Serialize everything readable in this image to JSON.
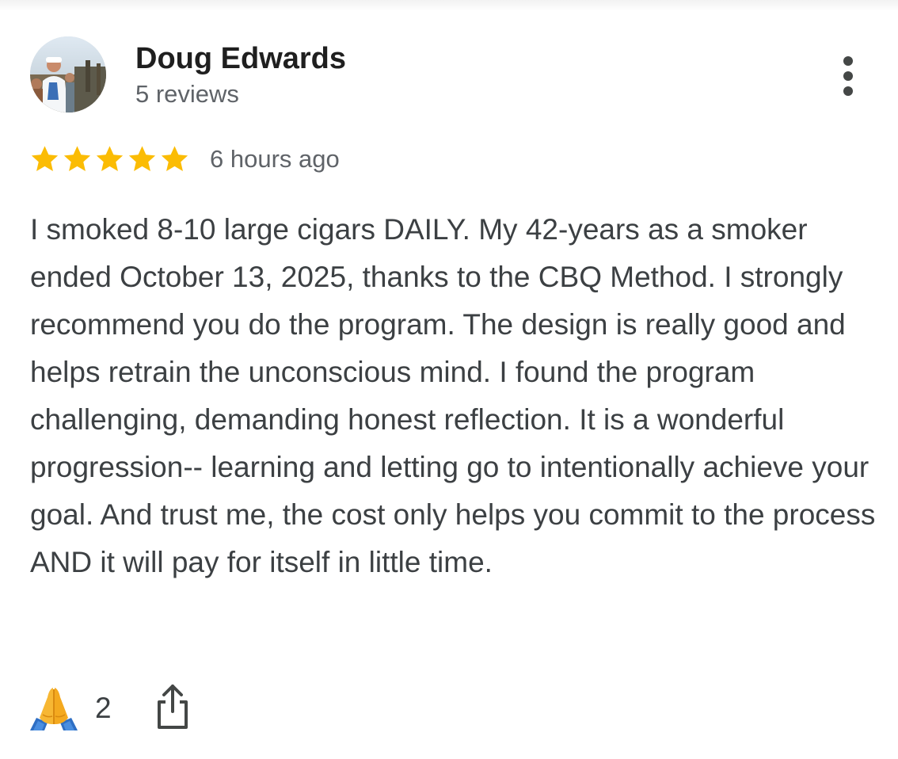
{
  "review": {
    "author": {
      "name": "Doug Edwards",
      "reviews_label": "5 reviews"
    },
    "rating": 5,
    "rating_max": 5,
    "time_ago": "6 hours ago",
    "text": "I smoked 8-10 large cigars DAILY. My 42-years as a smoker ended October 13, 2025, thanks to the CBQ Method. I strongly recommend you do the program. The design is really good and helps retrain the unconscious mind. I found the program challenging, demanding honest reflection. It is a wonderful progression-- learning and letting go to intentionally achieve your goal. And trust me, the cost only helps you commit to the process AND it will pay for itself in little time.",
    "reaction": {
      "icon": "folded-hands-icon",
      "count": "2"
    },
    "actions": {
      "more_icon": "more-vert-icon",
      "share_icon": "share-icon"
    }
  },
  "colors": {
    "star": "#fbbc04",
    "name": "#1f1f1f",
    "secondary": "#5f6368",
    "body": "#3c4043"
  }
}
